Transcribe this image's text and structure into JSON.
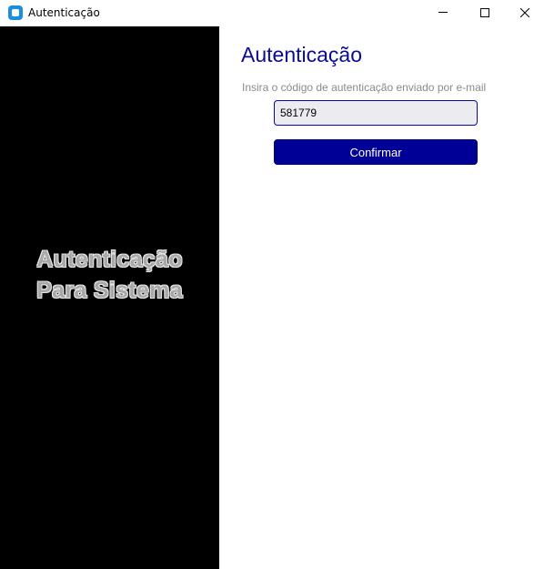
{
  "window": {
    "title": "Autenticação"
  },
  "left_panel": {
    "line1": "Autenticação",
    "line2": "Para Sistema"
  },
  "form": {
    "heading": "Autenticação",
    "subtitle": "Insira o código de autenticação enviado por e-mail",
    "code_value": "581779",
    "confirm_label": "Confirmar"
  },
  "colors": {
    "accent": "#000096",
    "heading": "#0a0a9a",
    "left_panel_bg": "#000000"
  }
}
